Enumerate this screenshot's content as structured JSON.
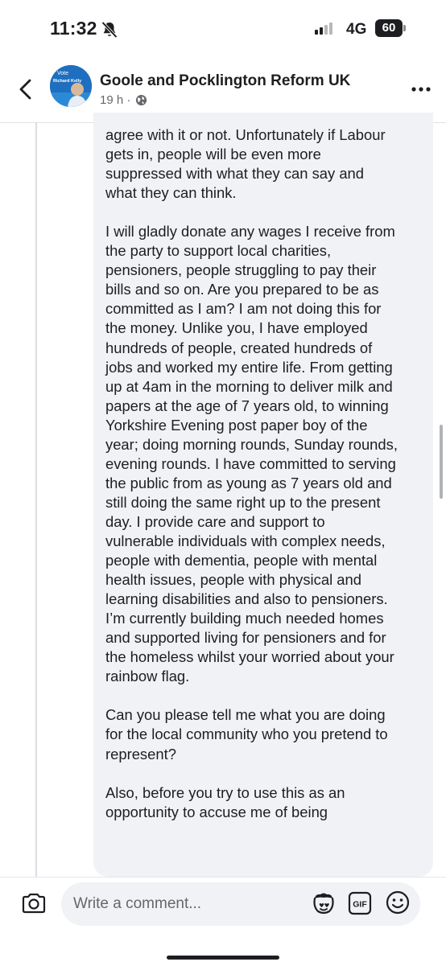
{
  "status_bar": {
    "time": "11:32",
    "network": "4G",
    "battery": "60",
    "icons": [
      "bell-slash-icon",
      "signal-icon",
      "battery-icon"
    ]
  },
  "header": {
    "group_name": "Goole and Pocklington Reform UK",
    "time_ago": "19 h ·",
    "avatar_text_top": "Vote",
    "avatar_text_name": "Richard Kelly",
    "icons": [
      "back-arrow-icon",
      "globe-icon",
      "more-options-icon"
    ]
  },
  "comment": {
    "text": "agree with it or not. Unfortunately if Labour\ngets in, people will be even more\nsuppressed with what they can say and\nwhat they can think.\n\nI will gladly donate any wages I receive from\nthe party to support local charities,\npensioners, people struggling to pay their\nbills and so on. Are you prepared to be as\ncommitted as I am? I am not doing this for\nthe money. Unlike you, I have employed\nhundreds of people, created hundreds of\njobs and worked my entire life. From getting\nup at 4am in the morning to deliver milk and\npapers at the age of 7 years old, to winning\nYorkshire Evening post paper boy of the\nyear; doing morning rounds, Sunday rounds,\nevening rounds. I have committed to serving\nthe public from as young as 7 years old and\nstill doing the same right up to the present\nday. I provide care and support to\nvulnerable individuals with complex needs,\npeople with dementia, people with mental\nhealth issues, people with physical and\nlearning disabilities and also to pensioners.\nI’m currently building much needed homes\nand supported living for pensioners and for\nthe homeless whilst your worried about your\nrainbow flag.\n\nCan you please tell me what you are doing\nfor the local community who you pretend to\nrepresent?\n\nAlso, before you try to use this as an\nopportunity to accuse me of being"
  },
  "comment_bar": {
    "placeholder": "Write a comment...",
    "gif_label": "GIF",
    "icons": [
      "camera-icon",
      "avatar-sticker-icon",
      "gif-icon",
      "emoji-icon"
    ]
  },
  "colors": {
    "bubble_bg": "#f0f2f5",
    "text": "#1c1e21",
    "secondary_text": "#65676b",
    "avatar_blue": "#1e6fbf"
  }
}
